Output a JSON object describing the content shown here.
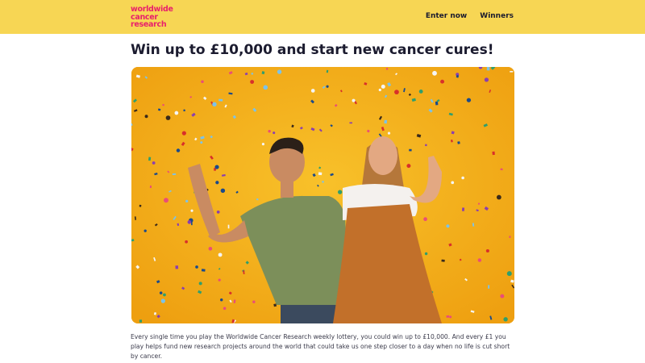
{
  "brand": {
    "logo_lines": [
      "worldwide",
      "cancer",
      "research"
    ],
    "color": "#e8206b"
  },
  "header": {
    "background": "#f7d654",
    "nav": [
      {
        "label": "Enter now"
      },
      {
        "label": "Winners"
      }
    ]
  },
  "main": {
    "title": "Win up to £10,000 and start new cancer cures!",
    "hero_image": {
      "description_icon": "celebrating-couple-confetti-image",
      "background": "#f4b31a"
    },
    "body": "Every single time you play the Worldwide Cancer Research weekly lottery, you could win up to £10,000. And every £1 you play helps fund new research projects around the world that could take us one step closer to a day when no life is cut short by cancer."
  }
}
